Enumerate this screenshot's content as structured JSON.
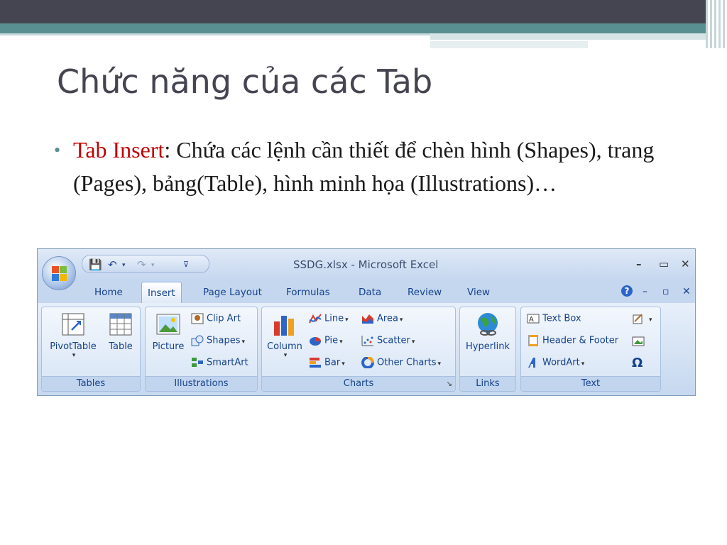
{
  "slide": {
    "title": "Chức năng của các Tab",
    "bullet_highlight": "Tab Insert",
    "bullet_text": ": Chứa các lệnh cần thiết để chèn hình (Shapes), trang (Pages), bảng(Table), hình minh họa (Illustrations)…"
  },
  "excel": {
    "window_title": "SSDG.xlsx - Microsoft Excel",
    "window_buttons": [
      "–",
      "▭",
      "✕"
    ],
    "ribbon_buttons": [
      "–",
      "▫",
      "✕"
    ],
    "help_label": "?",
    "tabs": [
      {
        "label": "Home",
        "active": false
      },
      {
        "label": "Insert",
        "active": true
      },
      {
        "label": "Page Layout",
        "active": false
      },
      {
        "label": "Formulas",
        "active": false
      },
      {
        "label": "Data",
        "active": false
      },
      {
        "label": "Review",
        "active": false
      },
      {
        "label": "View",
        "active": false
      }
    ],
    "groups": {
      "tables": {
        "label": "Tables",
        "pivot": "PivotTable",
        "table": "Table"
      },
      "illustrations": {
        "label": "Illustrations",
        "picture": "Picture",
        "clip_art": "Clip Art",
        "shapes": "Shapes",
        "smartart": "SmartArt"
      },
      "charts": {
        "label": "Charts",
        "column": "Column",
        "line": "Line",
        "pie": "Pie",
        "bar": "Bar",
        "area": "Area",
        "scatter": "Scatter",
        "other": "Other Charts"
      },
      "links": {
        "label": "Links",
        "hyperlink": "Hyperlink"
      },
      "text": {
        "label": "Text",
        "text_box": "Text Box",
        "header_footer": "Header & Footer",
        "wordart": "WordArt",
        "omega": "Ω"
      }
    }
  },
  "colors": {
    "accent": "#5a8f91",
    "highlight": "#c00000",
    "title": "#454551",
    "ribbon_text": "#15428b"
  }
}
